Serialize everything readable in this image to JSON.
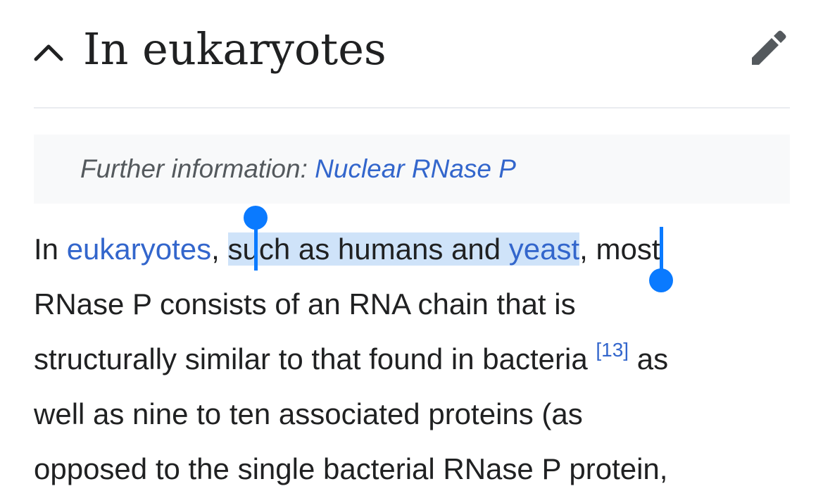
{
  "section": {
    "title": "In eukaryotes",
    "toggle_icon": "chevron-up-icon",
    "edit_icon": "pencil-icon"
  },
  "hatnote": {
    "prefix": "Further information: ",
    "link": "Nuclear RNase P"
  },
  "paragraph": {
    "line1": {
      "before": "In ",
      "link": "eukaryotes",
      "comma": ", ",
      "selected_plain": "such as humans and ",
      "selected_link": "yeast",
      "after": ", most"
    },
    "line2": "RNase P consists of an RNA chain that is",
    "line3": {
      "text": "structurally similar to that found in bacteria ",
      "cite": "[13]",
      "after": " as"
    },
    "line4": "well as nine to ten associated proteins (as",
    "line5": "opposed to the single bacterial RNase P protein,"
  },
  "colors": {
    "link": "#3366cc",
    "selection": "#cfe3f9",
    "handle": "#0a7aff",
    "text": "#202122"
  }
}
